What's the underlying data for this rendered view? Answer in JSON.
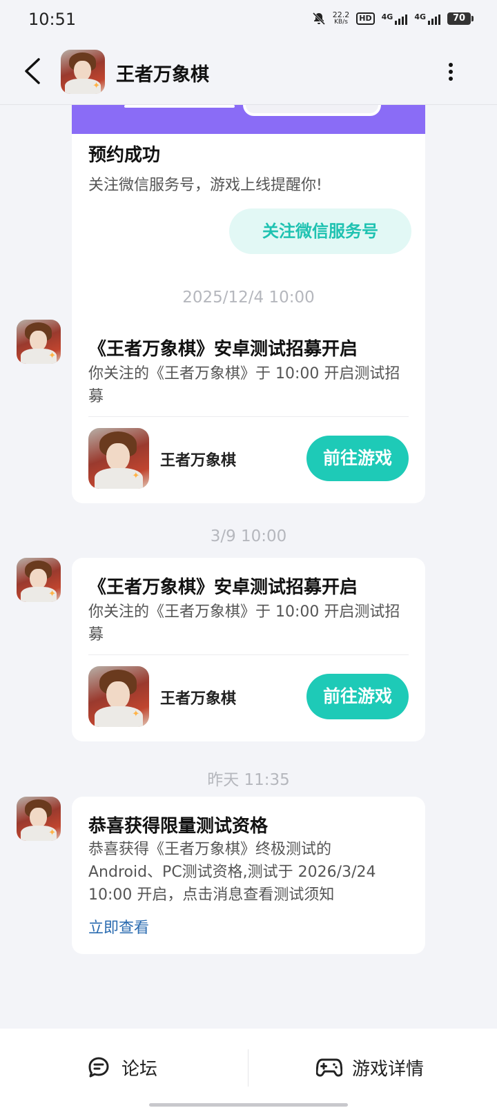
{
  "status_bar": {
    "time": "10:51",
    "speed_value": "22.2",
    "speed_unit": "KB/s",
    "hd": "HD",
    "net1": "4G",
    "net2": "4G",
    "battery": "70"
  },
  "header": {
    "title": "王者万象棋"
  },
  "first_card": {
    "title": "预约成功",
    "desc": "关注微信服务号，游戏上线提醒你!",
    "button": "关注微信服务号"
  },
  "messages": [
    {
      "time": "2025/12/4  10:00",
      "title": "《王者万象棋》安卓测试招募开启",
      "body": "你关注的《王者万象棋》于 10:00 开启测试招募",
      "game_name": "王者万象棋",
      "button": "前往游戏"
    },
    {
      "time": "3/9  10:00",
      "title": "《王者万象棋》安卓测试招募开启",
      "body": "你关注的《王者万象棋》于 10:00 开启测试招募",
      "game_name": "王者万象棋",
      "button": "前往游戏"
    },
    {
      "time": "昨天  11:35",
      "title": "恭喜获得限量测试资格",
      "body": "恭喜获得《王者万象棋》终极测试的Android、PC测试资格,测试于 2026/3/24 10:00 开启，点击消息查看测试须知",
      "link": "立即查看"
    }
  ],
  "bottom_bar": {
    "forum": "论坛",
    "game_detail": "游戏详情"
  },
  "colors": {
    "accent": "#1ecab7",
    "link": "#2a6bb0",
    "banner": "#8a6cf6",
    "background": "#f3f4f8"
  }
}
